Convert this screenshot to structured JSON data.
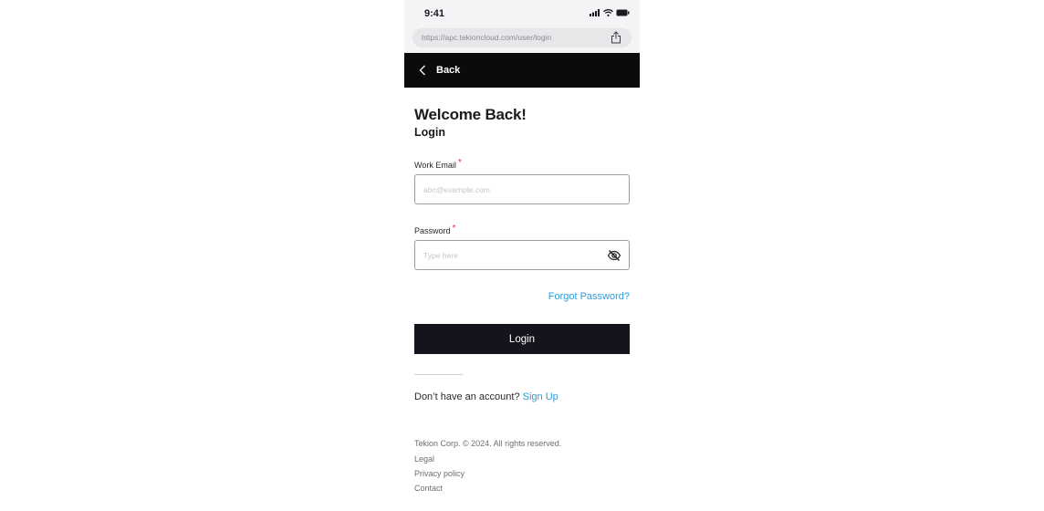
{
  "status_bar": {
    "time": "9:41"
  },
  "browser": {
    "url": "https://apc.tekioncloud.com/user/login"
  },
  "nav": {
    "back_label": "Back"
  },
  "header": {
    "title": "Welcome Back!",
    "subtitle": "Login"
  },
  "form": {
    "email": {
      "label": "Work Email",
      "required_mark": "*",
      "placeholder": "abc@example.com"
    },
    "password": {
      "label": "Password",
      "required_mark": "*",
      "placeholder": "Type here"
    },
    "forgot_link": "Forgot Password?",
    "submit_label": "Login"
  },
  "signup": {
    "prompt": "Don’t have an account?",
    "link": "Sign Up"
  },
  "footer": {
    "copyright": "Tekion Corp. © 2024. All rights reserved.",
    "links": [
      "Legal",
      "Privacy policy",
      "Contact"
    ]
  },
  "colors": {
    "accent": "#2f9bd8",
    "dark": "#14151c",
    "required": "#e53935"
  },
  "icons": [
    "signal-icon",
    "wifi-icon",
    "battery-icon",
    "share-icon",
    "chevron-left-icon",
    "eye-off-icon"
  ]
}
